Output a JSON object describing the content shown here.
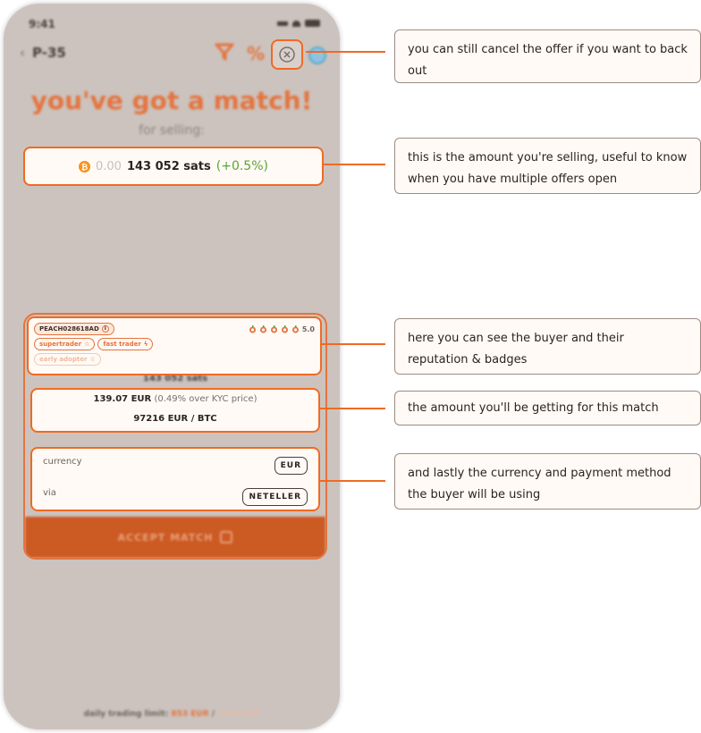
{
  "status_bar": {
    "time": "9:41"
  },
  "header": {
    "back_icon": "chevron-left-icon",
    "offer_id": "P-35",
    "icons": [
      "filter-icon",
      "percent-icon",
      "cancel-icon",
      "help-icon"
    ]
  },
  "match": {
    "title": "you've got a match!",
    "subtitle": "for selling:",
    "amount_btc_prefix": "0.00",
    "amount_sats": "143 052 sats",
    "premium": "(+0.5%)"
  },
  "offer": {
    "buyer_id": "PEACH028618AD",
    "rating": "5.0",
    "rating_count": 5,
    "badges": [
      {
        "label": "supertrader",
        "icon": "star-icon",
        "active": true
      },
      {
        "label": "fast trader",
        "icon": "lightning-icon",
        "active": true
      },
      {
        "label": "early adopter",
        "icon": "trophy-icon",
        "active": false
      }
    ],
    "sats_behind": "143 052 sats",
    "price_fiat": "139.07 EUR",
    "price_note": "(0.49% over KYC price)",
    "rate": "97216 EUR / BTC",
    "currency_label": "currency",
    "currency_value": "EUR",
    "via_label": "via",
    "via_value": "NETELLER",
    "accept_label": "ACCEPT MATCH"
  },
  "trading_limit": {
    "label": "daily trading limit:",
    "used": "853 EUR",
    "separator": "/",
    "max": "1 065 EUR",
    "fraction_used": 0.8
  },
  "callouts": [
    "you can still cancel the offer if you want to back out",
    "this is the amount you're selling, useful to know when you have multiple offers open",
    "here you can see the buyer and their reputation & badges",
    "the amount you'll be getting for this match",
    "and lastly the currency and payment method the buyer will be using"
  ],
  "colors": {
    "accent": "#f06a22",
    "brand_orange": "#e4743f",
    "positive_green": "#5aa531",
    "phone_bg": "#ccc3be"
  }
}
